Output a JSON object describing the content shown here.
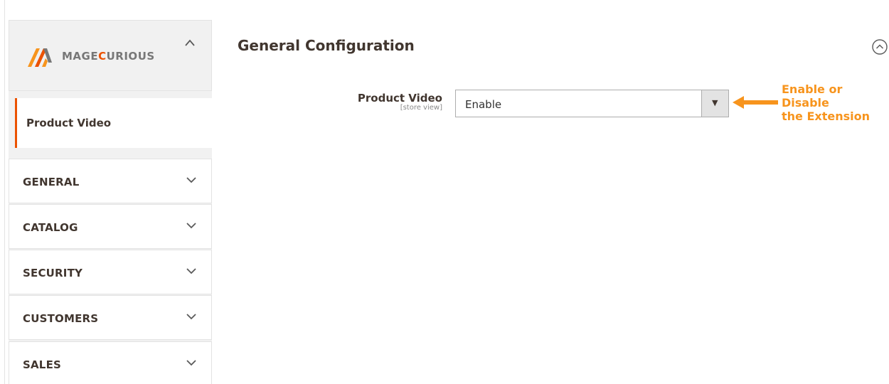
{
  "brand": {
    "logo_text_prefix": "MAGE",
    "logo_text_highlight": "C",
    "logo_text_suffix": "URIOUS",
    "icon": "magecurious-logo",
    "toggle_icon": "chevron-up-icon"
  },
  "sidebar": {
    "active_item": "Product Video",
    "items": [
      {
        "label": "GENERAL",
        "icon": "chevron-down-icon"
      },
      {
        "label": "CATALOG",
        "icon": "chevron-down-icon"
      },
      {
        "label": "SECURITY",
        "icon": "chevron-down-icon"
      },
      {
        "label": "CUSTOMERS",
        "icon": "chevron-down-icon"
      },
      {
        "label": "SALES",
        "icon": "chevron-down-icon"
      }
    ]
  },
  "main": {
    "section_title": "General Configuration",
    "collapse_icon": "circle-chevron-up-icon",
    "field": {
      "label": "Product Video",
      "scope": "[store view]",
      "value": "Enable",
      "dropdown_icon": "triangle-down-icon"
    }
  },
  "annotation": {
    "lines": [
      "Enable or",
      "Disable",
      "the Extension"
    ],
    "icon": "arrow-left-icon"
  },
  "colors": {
    "accent": "#eb5202",
    "annotation": "#f7941d",
    "sidebar_bg": "#f1f1f1",
    "text_dark": "#41362f"
  }
}
